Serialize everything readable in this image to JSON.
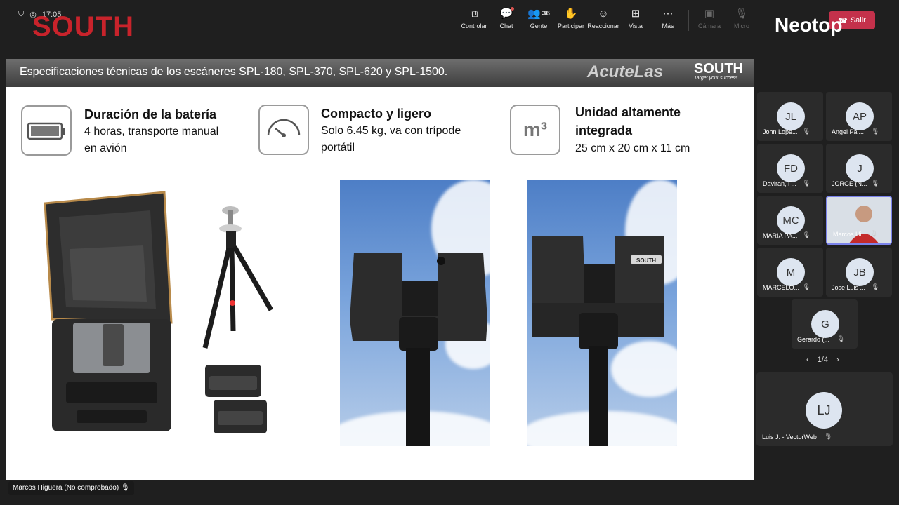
{
  "topbar": {
    "time": "17:05",
    "brand": "SOUTH",
    "tools": [
      {
        "label": "Controlar",
        "icon": "share-screen-icon"
      },
      {
        "label": "Chat",
        "icon": "chat-icon"
      },
      {
        "label": "Gente",
        "icon": "people-icon",
        "count": "36"
      },
      {
        "label": "Participar",
        "icon": "raise-hand-icon"
      },
      {
        "label": "Reaccionar",
        "icon": "smile-icon"
      },
      {
        "label": "Vista",
        "icon": "grid-icon"
      },
      {
        "label": "Más",
        "icon": "more-icon"
      },
      {
        "label": "Cámara",
        "icon": "camera-off-icon"
      },
      {
        "label": "Micro",
        "icon": "mic-off-icon"
      }
    ],
    "leave_label": "Salir",
    "watermark": "Neotop"
  },
  "slide": {
    "title": "Especificaciones técnicas de los escáneres SPL-180, SPL-370, SPL-620 y SPL-1500.",
    "logo1": "AcuteLas",
    "logo2": "SOUTH",
    "logo2_tagline": "Target your success",
    "specs": [
      {
        "title": "Duración de la batería",
        "desc1": "4 horas, transporte manual",
        "desc2": "en avión"
      },
      {
        "title": "Compacto y ligero",
        "desc1": "Solo 6.45 kg, va con trípode",
        "desc2": "portátil"
      },
      {
        "title1": "Unidad altamente",
        "title2": "integrada",
        "desc1": "25 cm x 20 cm x 11 cm",
        "icon_text": "m³"
      }
    ],
    "scanner_brand": "SOUTH"
  },
  "participants": [
    {
      "initials": "JL",
      "name": "John Lope..."
    },
    {
      "initials": "AP",
      "name": "Angel Pal..."
    },
    {
      "initials": "FD",
      "name": "Daviran, F..."
    },
    {
      "initials": "J",
      "name": "JORGE (N..."
    },
    {
      "initials": "MC",
      "name": "MARIA PA..."
    },
    {
      "initials": "",
      "name": "Marcos Hi..."
    },
    {
      "initials": "M",
      "name": "MARCELO..."
    },
    {
      "initials": "JB",
      "name": "Jose Luis ..."
    },
    {
      "initials": "G",
      "name": "Gerardo (..."
    }
  ],
  "pager": {
    "label": "1/4"
  },
  "featured": {
    "initials": "LJ",
    "name": "Luis J. - VectorWeb"
  },
  "presenter": {
    "name": "Marcos Higuera (No comprobado)"
  },
  "colors": {
    "accent_red": "#c4314b",
    "brand_red": "#c8232b",
    "active_border": "#7b83eb"
  }
}
